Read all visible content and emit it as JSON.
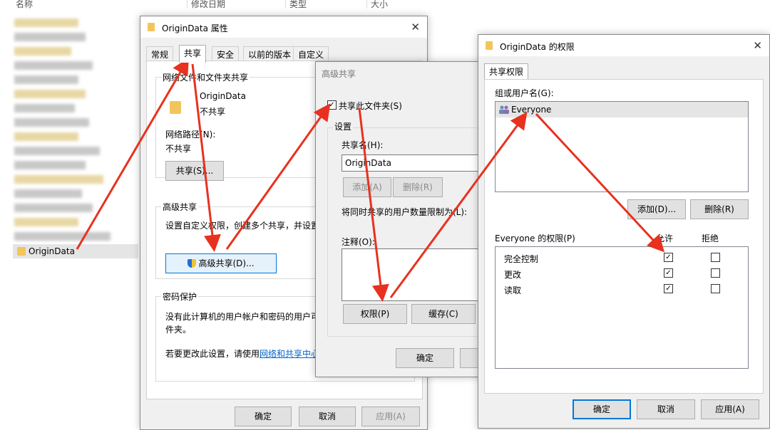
{
  "explorer": {
    "col_name": "名称",
    "col_modified": "修改日期",
    "col_type": "类型",
    "col_size": "大小",
    "selected_item": "OriginData"
  },
  "props": {
    "title": "OriginData 属性",
    "tabs": [
      "常规",
      "共享",
      "安全",
      "以前的版本",
      "自定义"
    ],
    "net_share_group": "网络文件和文件夹共享",
    "folder_name": "OriginData",
    "folder_status": "不共享",
    "net_path_label": "网络路径(N):",
    "net_path_value": "不共享",
    "share_button": "共享(S)...",
    "adv_group": "高级共享",
    "adv_desc": "设置自定义权限，创建多个共享，并设置其",
    "adv_button": "高级共享(D)...",
    "pwd_group": "密码保护",
    "pwd_desc1": "没有此计算机的用户帐户和密码的用户可以",
    "pwd_desc2": "件夹。",
    "pwd_link_pre": "若要更改此设置，请使用",
    "pwd_link": "网络和共享中心",
    "pwd_link_post": "。",
    "ok": "确定",
    "cancel": "取消",
    "apply": "应用(A)"
  },
  "adv": {
    "title": "高级共享",
    "share_checkbox": "共享此文件夹(S)",
    "settings": "设置",
    "share_name_label": "共享名(H):",
    "share_name_value": "OriginData",
    "add": "添加(A)",
    "remove": "删除(R)",
    "limit_label": "将同时共享的用户数量限制为(L):",
    "comment_label": "注释(O):",
    "permissions": "权限(P)",
    "cache": "缓存(C)",
    "ok": "确定"
  },
  "perm": {
    "title": "OriginData 的权限",
    "tab": "共享权限",
    "group_label": "组或用户名(G):",
    "user": "Everyone",
    "add": "添加(D)...",
    "remove": "删除(R)",
    "perm_for": "Everyone 的权限(P)",
    "allow": "允许",
    "deny": "拒绝",
    "rows": [
      {
        "name": "完全控制",
        "allow": "✓",
        "deny": ""
      },
      {
        "name": "更改",
        "allow": "✓",
        "deny": ""
      },
      {
        "name": "读取",
        "allow": "✓",
        "deny": ""
      }
    ],
    "ok": "确定",
    "cancel": "取消",
    "apply": "应用(A)"
  },
  "colors": {
    "arrow": "#e8311f",
    "accent": "#0078d7",
    "folder": "#f2c55c"
  }
}
